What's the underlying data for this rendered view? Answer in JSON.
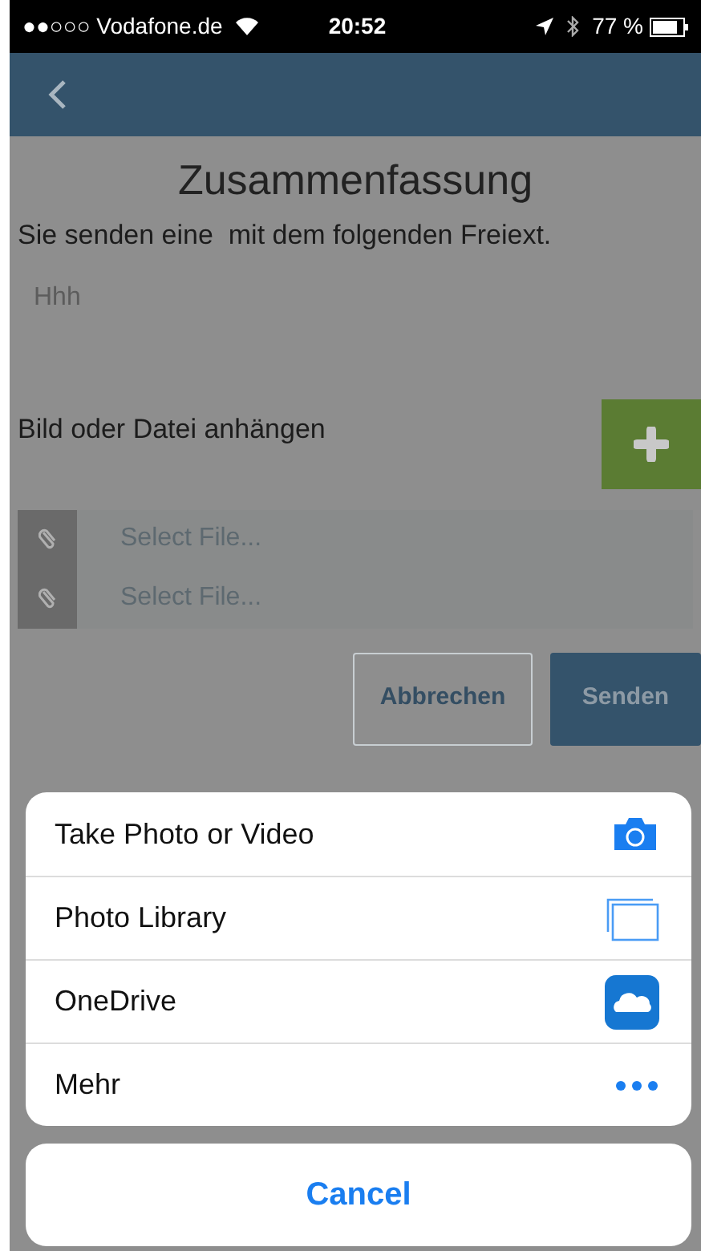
{
  "status_bar": {
    "carrier": "●●○○○ Vodafone.de",
    "time": "20:52",
    "battery": "77 %"
  },
  "summary": {
    "title": "Zusammenfassung",
    "text": "Sie senden eine  mit dem folgenden Freiext.",
    "freetext": "Hhh"
  },
  "attach": {
    "label": "Bild oder Datei anhängen",
    "files": [
      {
        "placeholder": "Select File..."
      },
      {
        "placeholder": "Select File..."
      }
    ]
  },
  "buttons": {
    "cancel": "Abbrechen",
    "send": "Senden"
  },
  "action_sheet": {
    "items": [
      {
        "label": "Take Photo or Video",
        "kind": "camera"
      },
      {
        "label": "Photo Library",
        "kind": "library"
      },
      {
        "label": "OneDrive",
        "kind": "cloud"
      },
      {
        "label": "Mehr",
        "kind": "more"
      }
    ],
    "cancel": "Cancel"
  }
}
